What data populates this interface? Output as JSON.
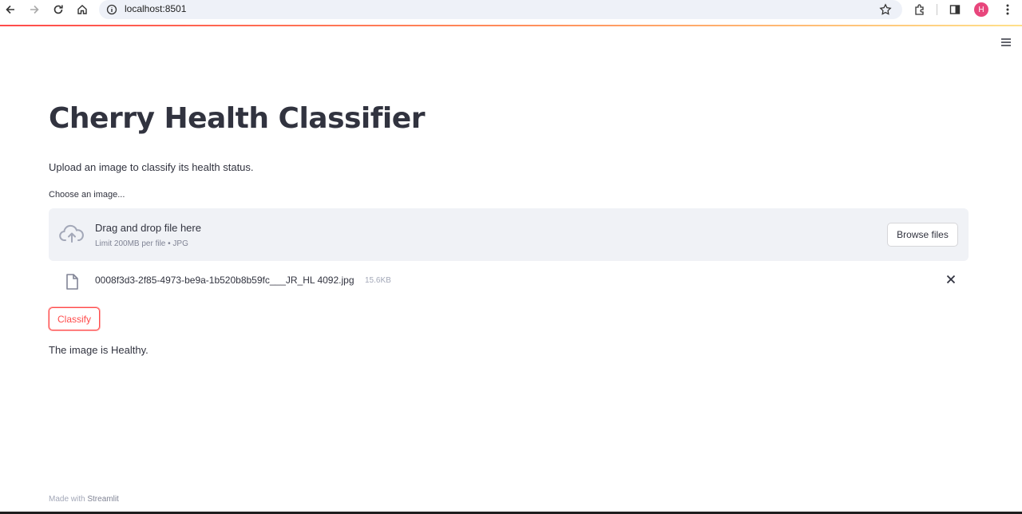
{
  "browser": {
    "url": "localhost:8501",
    "avatar_initial": "H"
  },
  "app": {
    "title": "Cherry Health Classifier",
    "subtitle": "Upload an image to classify its health status.",
    "uploader": {
      "label": "Choose an image...",
      "drop_text": "Drag and drop file here",
      "limit_text": "Limit 200MB per file • JPG",
      "browse_label": "Browse files"
    },
    "file": {
      "name": "0008f3d3-2f85-4973-be9a-1b520b8b59fc___JR_HL 4092.jpg",
      "size": "15.6KB"
    },
    "classify_label": "Classify",
    "result_text": "The image is Healthy."
  },
  "footer": {
    "prefix": "Made with",
    "brand": "Streamlit"
  },
  "colors": {
    "accent": "#ff4b4b",
    "dropzone_bg": "#f0f2f6",
    "text": "#31333f"
  }
}
